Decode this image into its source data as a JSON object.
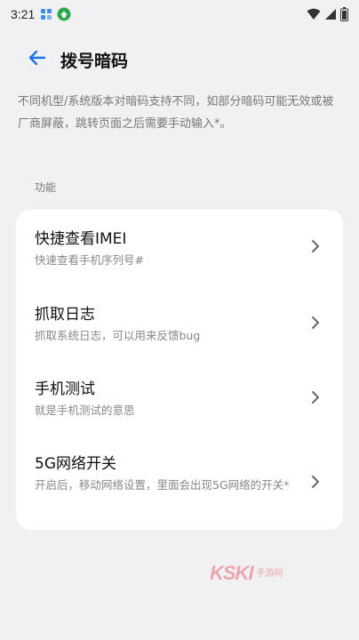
{
  "status_bar": {
    "time": "3:21",
    "icons": [
      "grid-app-icon",
      "green-app-icon",
      "wifi-icon",
      "signal-icon",
      "battery-icon"
    ]
  },
  "header": {
    "back_icon": "arrow-left-icon",
    "title": "拨号暗码"
  },
  "description": "不同机型/系统版本对暗码支持不同，如部分暗码可能无效或被厂商屏蔽，跳转页面之后需要手动输入*。",
  "section_label": "功能",
  "items": [
    {
      "title": "快捷查看IMEI",
      "subtitle": "快速查看手机序列号#"
    },
    {
      "title": "抓取日志",
      "subtitle": "抓取系统日志，可以用来反馈bug"
    },
    {
      "title": "手机测试",
      "subtitle": "就是手机测试的意思"
    },
    {
      "title": "5G网络开关",
      "subtitle": "开启后，移动网络设置，里面会出现5G网络的开关*"
    }
  ],
  "watermark": {
    "logo": "KSKI",
    "text": "手游网"
  },
  "colors": {
    "accent": "#1a73e8",
    "background": "#f1f1f3",
    "card": "#ffffff"
  }
}
